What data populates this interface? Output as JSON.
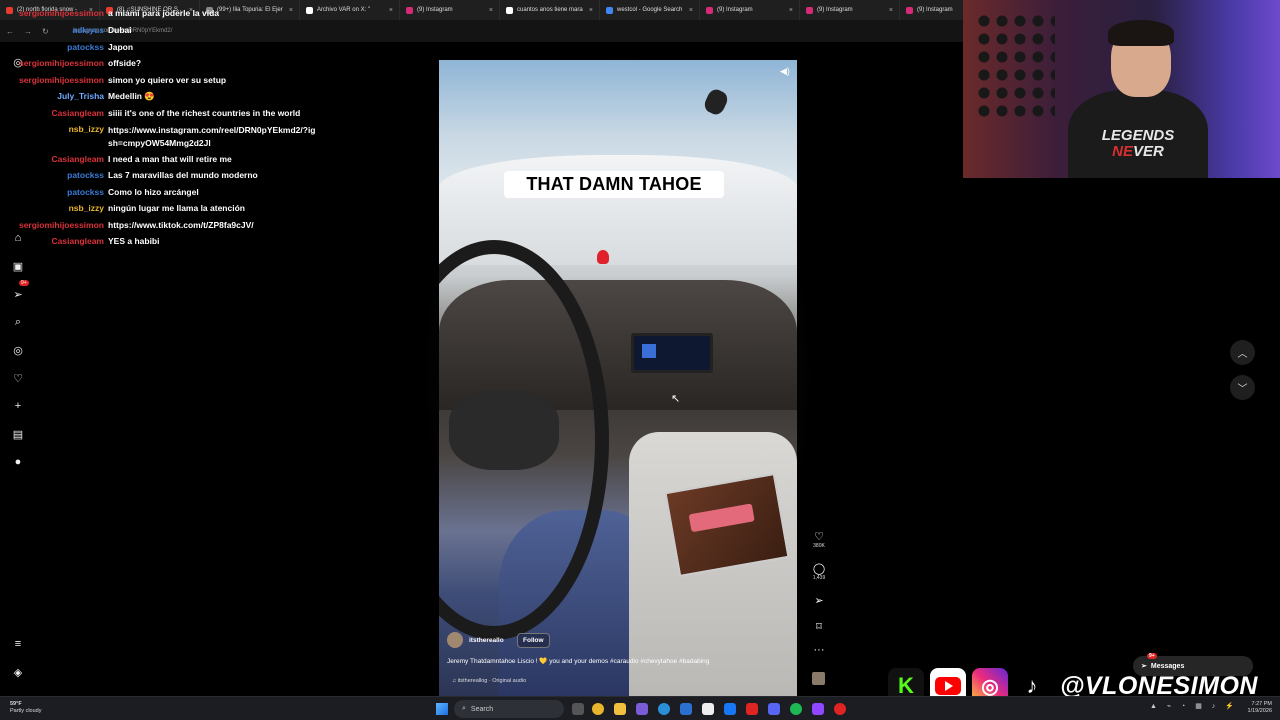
{
  "browser": {
    "tabs": [
      {
        "title": "(2) north florida snow -",
        "color": "#e63b2e"
      },
      {
        "title": "(8) ♫SUNSHINE OR S..",
        "color": "#e63b2e"
      },
      {
        "title": "(99+) Ilia Topuria: El Ejer",
        "color": "#888888"
      },
      {
        "title": "Archivo VAR on X: \"",
        "color": "#ffffff"
      },
      {
        "title": "(9) Instagram",
        "color": "#d62976"
      },
      {
        "title": "cuantos anos tiene mara",
        "color": "#ffffff"
      },
      {
        "title": "westcol - Google Search",
        "color": "#4285f4"
      },
      {
        "title": "(9) Instagram",
        "color": "#d62976"
      },
      {
        "title": "(9) Instagram",
        "color": "#d62976"
      },
      {
        "title": "(9) Instagram",
        "color": "#d62976"
      }
    ],
    "url": "instagram.com/reels/DRN0pYEkmd2/"
  },
  "chat": [
    {
      "user": "sergiomihijoessimon",
      "msg": "a miami para joderle la vida",
      "color": "#d9323a"
    },
    {
      "user": "adlayus",
      "msg": "Dubai",
      "color": "#3a7bd5"
    },
    {
      "user": "patockss",
      "msg": "Japon",
      "color": "#3a7bd5"
    },
    {
      "user": "sergiomihijoessimon",
      "msg": "offside?",
      "color": "#d9323a"
    },
    {
      "user": "sergiomihijoessimon",
      "msg": "simon yo quiero ver su setup",
      "color": "#d9323a"
    },
    {
      "user": "July_Trisha",
      "msg": "Medellin 😍",
      "color": "#6fa8ff"
    },
    {
      "user": "Casiangleam",
      "msg": "siiii it's one of the richest countries in the world",
      "color": "#d9323a"
    },
    {
      "user": "nsb_izzy",
      "msg": "https://www.instagram.com/reel/DRN0pYEkmd2/?igsh=cmpyOW54Mmg2d2Jl",
      "color": "#e8b62c"
    },
    {
      "user": "Casiangleam",
      "msg": "I need a man that will retire me",
      "color": "#d9323a"
    },
    {
      "user": "patockss",
      "msg": "Las 7 maravillas del mundo moderno",
      "color": "#3a7bd5"
    },
    {
      "user": "patockss",
      "msg": "Como lo hizo arcángel",
      "color": "#3a7bd5"
    },
    {
      "user": "nsb_izzy",
      "msg": "ningún lugar me llama la atención",
      "color": "#e8b62c"
    },
    {
      "user": "sergiomihijoessimon",
      "msg": "https://www.tiktok.com/t/ZP8fa9cJV/",
      "color": "#d9323a"
    },
    {
      "user": "Casiangleam",
      "msg": "YES a habibi",
      "color": "#d9323a"
    }
  ],
  "sidebar": {
    "items": [
      {
        "icon": "instagram-icon"
      },
      {
        "icon": "home-icon"
      },
      {
        "icon": "reels-icon"
      },
      {
        "icon": "send-icon",
        "badge": "9+"
      },
      {
        "icon": "search-icon"
      },
      {
        "icon": "explore-icon"
      },
      {
        "icon": "heart-icon"
      },
      {
        "icon": "plus-icon"
      },
      {
        "icon": "dashboard-icon"
      },
      {
        "icon": "profile-icon"
      },
      {
        "icon": "menu-icon"
      },
      {
        "icon": "meta-icon"
      }
    ]
  },
  "video": {
    "caption_overlay": "THAT DAMN TAHOE",
    "username": "itsthereallo",
    "follow_label": "Follow",
    "description": "Jeremy Thatdamntahoe Liscio ! 💛 you and your demos #caraudio #chevytahoe #badabing",
    "audio": "♫ itsthereallog · Original audio",
    "likes": "380K",
    "comments": "1,439"
  },
  "webcam": {
    "shirt_line1": "LEGENDS",
    "shirt_line2_a": "NE",
    "shirt_line2_b": "VER"
  },
  "socials": {
    "kick": "K",
    "instagram": "◎",
    "tiktok": "♪",
    "handle": "@VLONESIMON"
  },
  "messages": {
    "label": "Messages",
    "badge": "9+"
  },
  "taskbar": {
    "temp": "59°F",
    "weather": "Partly cloudy",
    "search": "Search",
    "time": "7:27 PM",
    "date": "1/19/2026"
  }
}
